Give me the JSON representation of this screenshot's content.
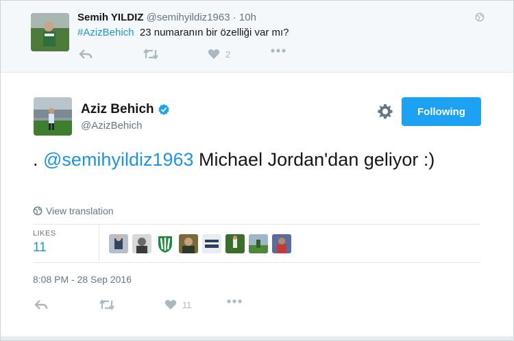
{
  "parent_tweet": {
    "name": "Semih YILDIZ",
    "handle": "@semihyildiz1963",
    "separator": "·",
    "time": "10h",
    "hashtag": "#AzizBehich",
    "text": "23 numaranın bir özelliği var mı?",
    "like_count": "2"
  },
  "main_tweet": {
    "name": "Aziz Behich",
    "handle": "@AzizBehich",
    "follow_label": "Following",
    "text_prefix": ". ",
    "mention": "@semihyildiz1963",
    "text_rest": " Michael Jordan'dan geliyor :)",
    "translate_label": "View translation",
    "likes_label": "LIKES",
    "likes_count": "11",
    "timestamp": "8:08 PM - 28 Sep 2016",
    "like_count": "11"
  },
  "colors": {
    "accent": "#1da1f2",
    "link": "#1b95e0",
    "muted": "#657786",
    "icon": "#aab8c2"
  }
}
